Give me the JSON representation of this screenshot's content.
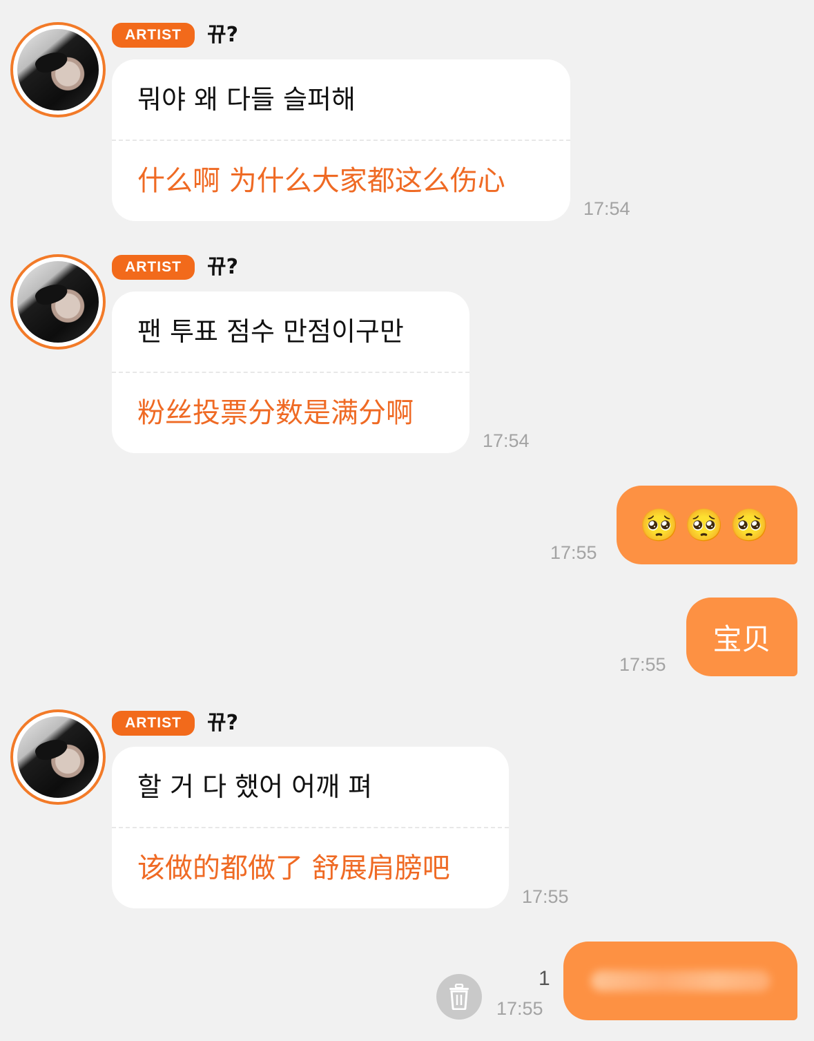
{
  "messages": [
    {
      "badge": "ARTIST",
      "name": "뀨?",
      "korean": "뭐야 왜 다들 슬퍼해",
      "chinese": "什么啊 为什么大家都这么伤心",
      "time": "17:54"
    },
    {
      "badge": "ARTIST",
      "name": "뀨?",
      "korean": "팬 투표 점수 만점이구만",
      "chinese": "粉丝投票分数是满分啊",
      "time": "17:54"
    },
    {
      "outgoing": true,
      "text": "🥺🥺🥺",
      "time": "17:55"
    },
    {
      "outgoing": true,
      "text": "宝贝",
      "time": "17:55"
    },
    {
      "badge": "ARTIST",
      "name": "뀨?",
      "korean": "할 거 다 했어 어깨 펴",
      "chinese": "该做的都做了 舒展肩膀吧",
      "time": "17:55"
    },
    {
      "outgoing": true,
      "text": "",
      "unread": "1",
      "time": "17:55"
    }
  ],
  "colors": {
    "accent": "#f26a1b",
    "outgoing_bubble": "#fd9143",
    "translation_text": "#ef6a24",
    "background": "#f1f1f1"
  },
  "icons": {
    "delete": "trash-icon"
  }
}
